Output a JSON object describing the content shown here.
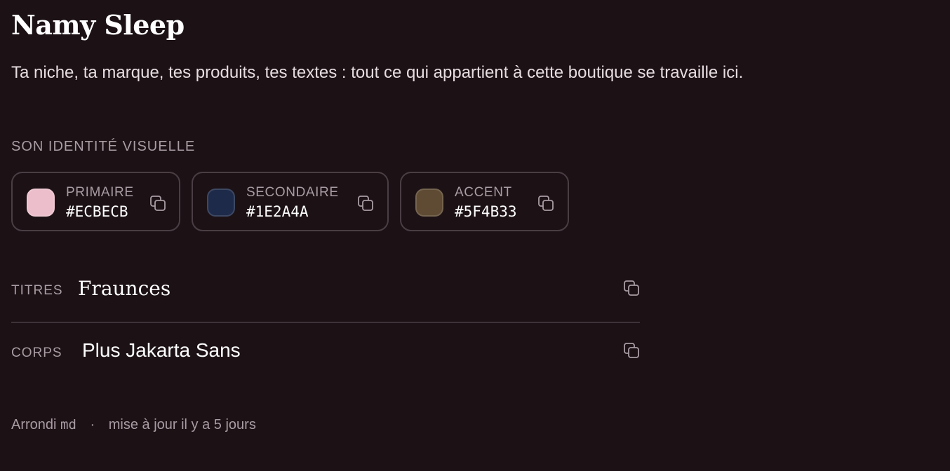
{
  "page": {
    "title": "Namy Sleep",
    "subtitle": "Ta niche, ta marque, tes produits, tes textes : tout ce qui appartient à cette boutique se travaille ici."
  },
  "identity": {
    "section_label": "SON IDENTITÉ VISUELLE",
    "colors": [
      {
        "name": "PRIMAIRE",
        "hex": "#ECBECB",
        "swatch": "#ECBECB",
        "copy_icon": "copy-icon"
      },
      {
        "name": "SECONDAIRE",
        "hex": "#1E2A4A",
        "swatch": "#1E2A4A",
        "copy_icon": "copy-icon"
      },
      {
        "name": "ACCENT",
        "hex": "#5F4B33",
        "swatch": "#5F4B33",
        "copy_icon": "copy-icon"
      }
    ]
  },
  "typography": {
    "rows": [
      {
        "label": "TITRES",
        "font": "Fraunces",
        "copy_icon": "copy-icon"
      },
      {
        "label": "CORPS",
        "font": "Plus Jakarta Sans",
        "copy_icon": "copy-icon"
      }
    ]
  },
  "footer": {
    "radius_prefix": "Arrondi",
    "radius_value": "md",
    "separator": "·",
    "updated": "mise à jour il y a 5 jours"
  },
  "theme": {
    "background": "#1C1216",
    "border": "#4A3E44",
    "muted_text": "#A99CA3",
    "text": "#FFFFFF"
  }
}
